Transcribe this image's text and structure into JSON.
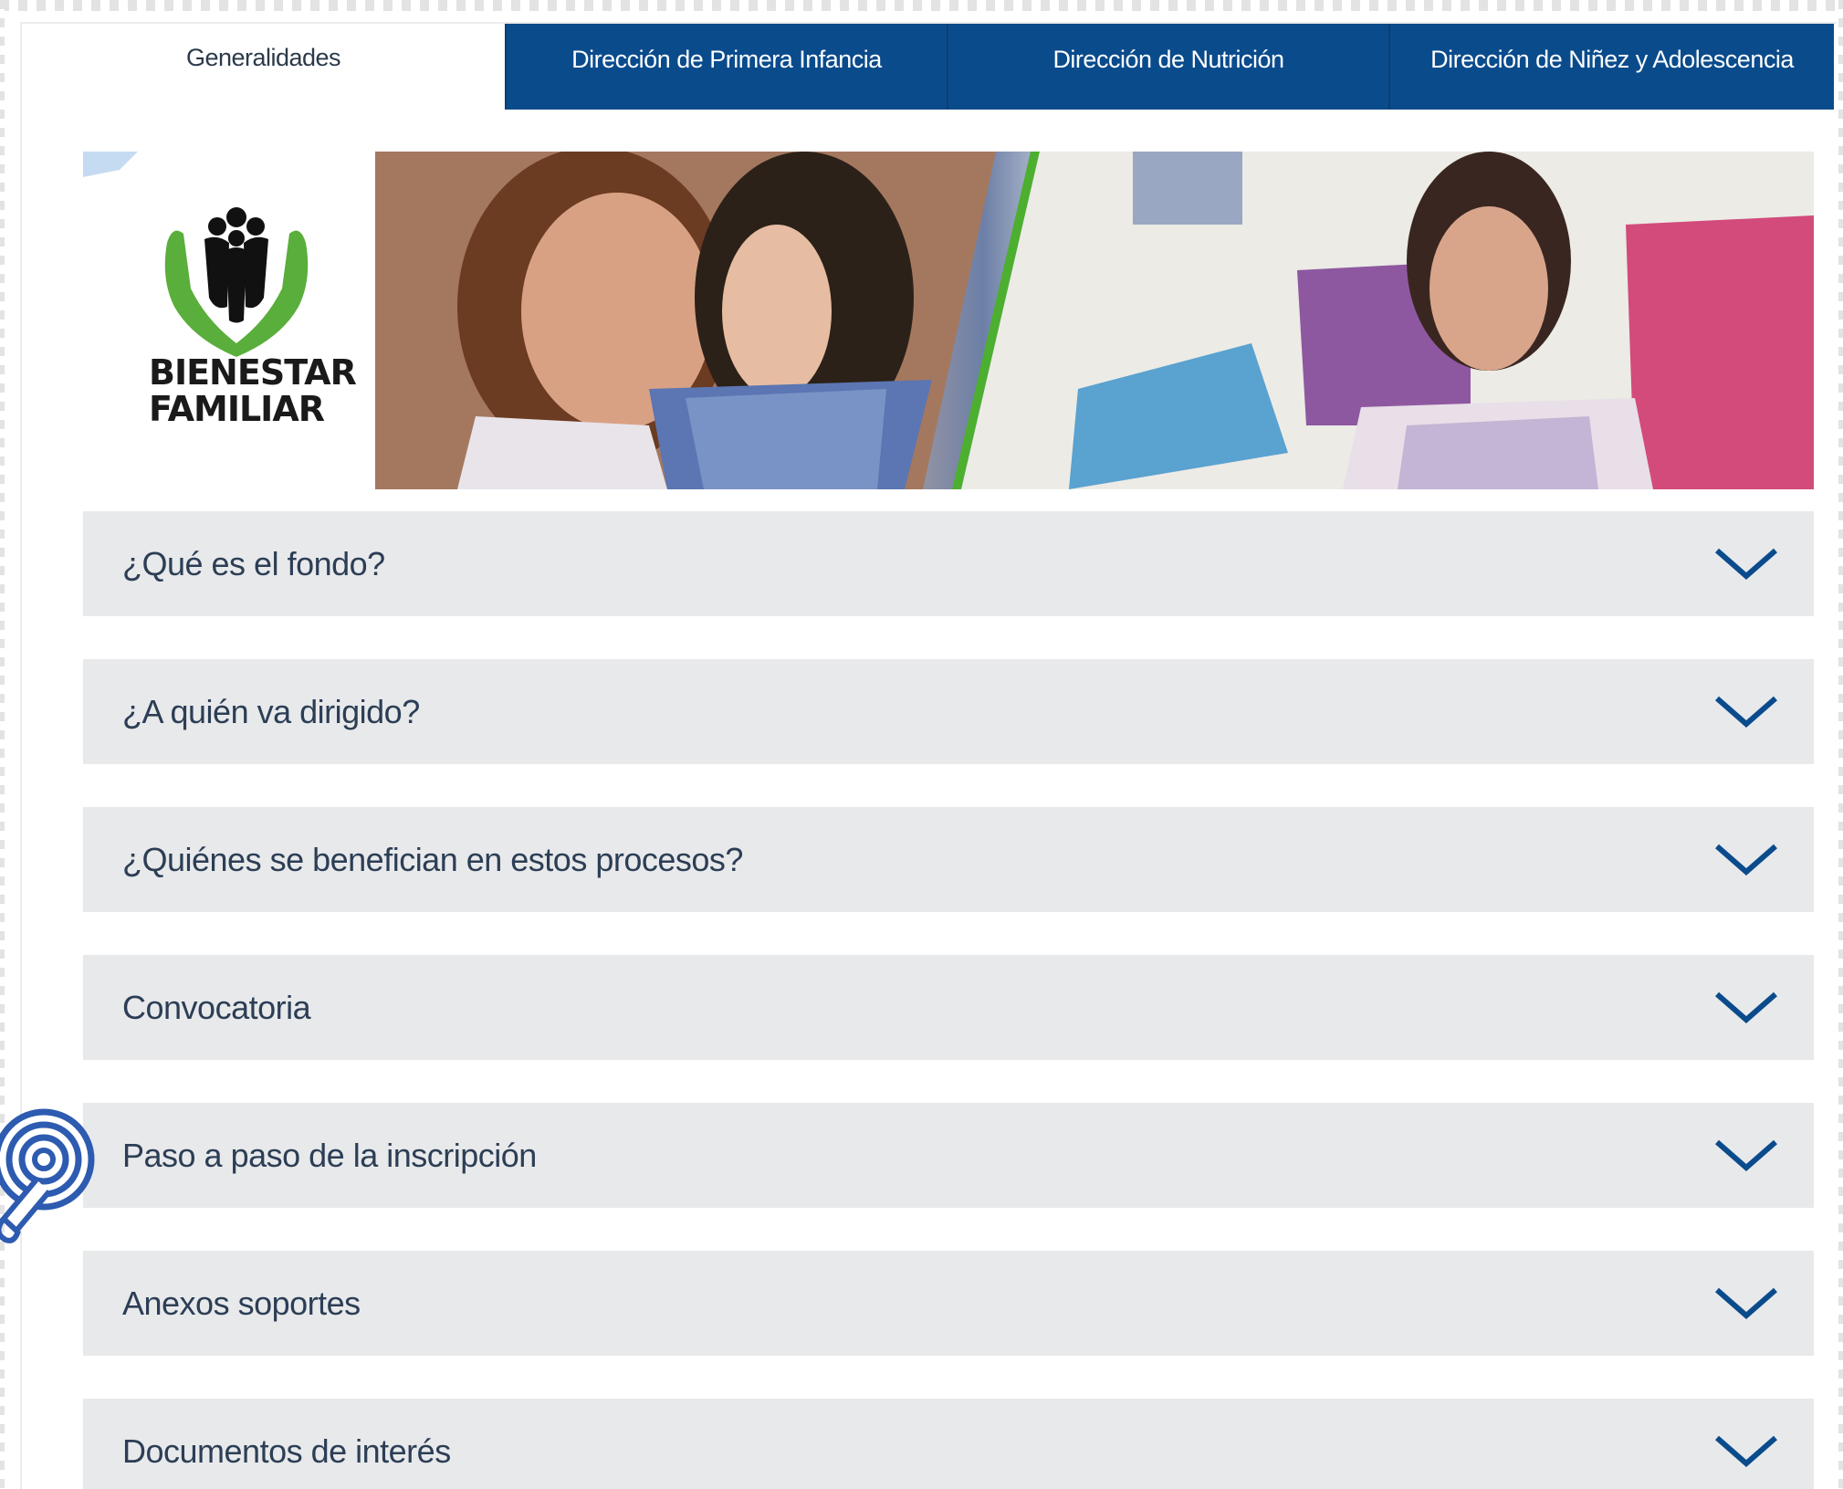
{
  "tabs": [
    {
      "label": "Generalidades",
      "active": true
    },
    {
      "label": "Dirección de Primera Infancia",
      "active": false
    },
    {
      "label": "Dirección de Nutrición",
      "active": false
    },
    {
      "label": "Dirección de Niñez y Adolescencia",
      "active": false
    }
  ],
  "banner": {
    "logo_line1": "BIENESTAR",
    "logo_line2": "FAMILIAR"
  },
  "accordion": [
    {
      "label": "¿Qué es el fondo?"
    },
    {
      "label": "¿A quién va dirigido?"
    },
    {
      "label": "¿Quiénes se benefician en estos procesos?"
    },
    {
      "label": "Convocatoria"
    },
    {
      "label": "Paso a paso de la inscripción"
    },
    {
      "label": "Anexos soportes"
    },
    {
      "label": "Documentos de interés"
    }
  ],
  "colors": {
    "tab_blue": "#0a4b8c",
    "accordion_bg": "#e8e9eb",
    "chevron": "#0a4b8c",
    "logo_green": "#5aae3b"
  },
  "icons": {
    "chevron": "chevron-down-icon",
    "assist": "hearing-assist-icon"
  }
}
